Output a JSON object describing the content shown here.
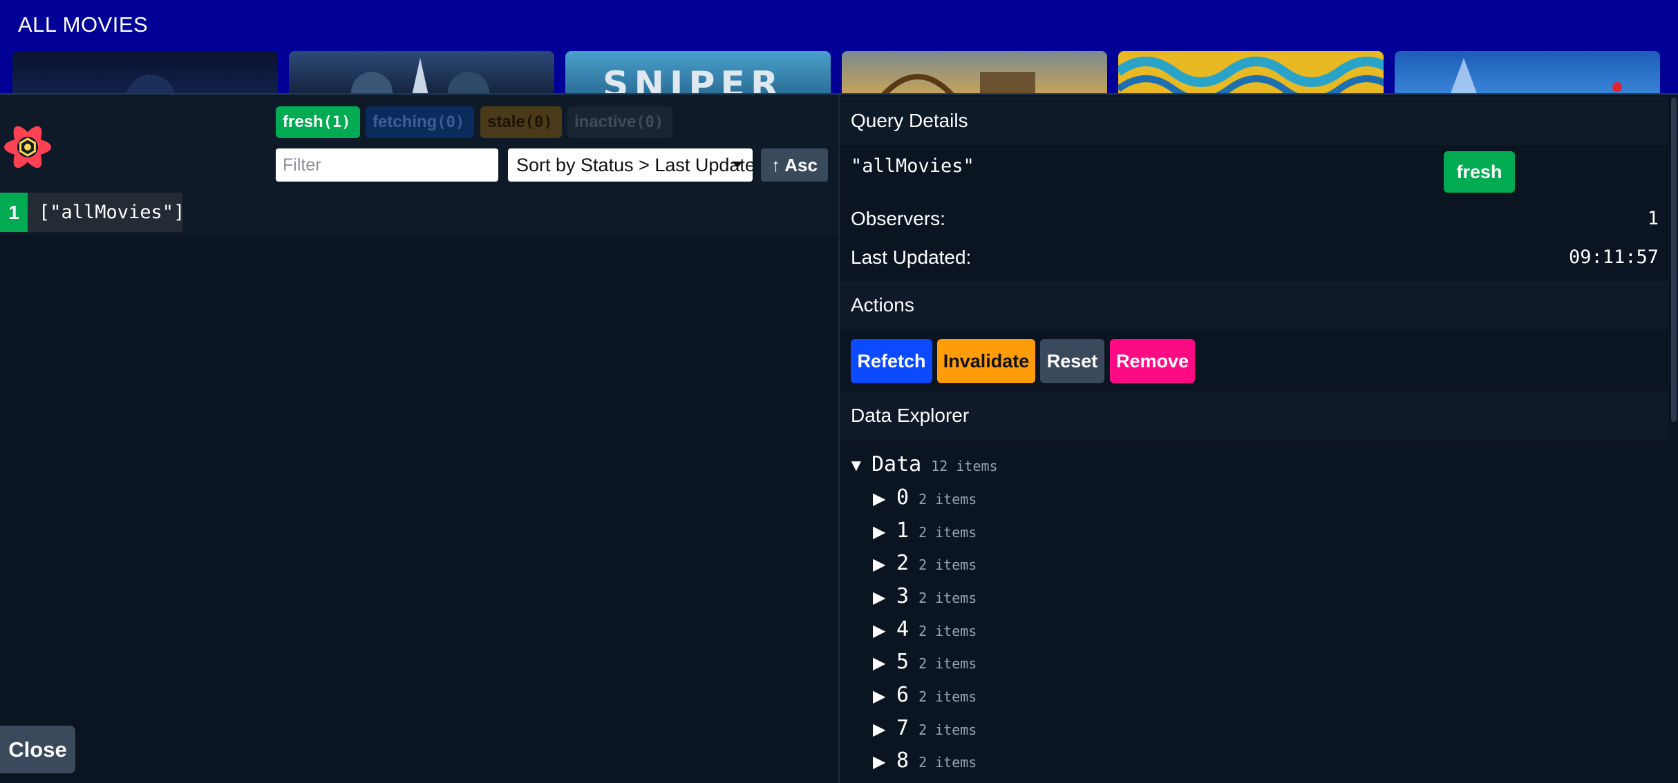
{
  "app": {
    "title": "ALL MOVIES",
    "posters": [
      {
        "name": "poster-1"
      },
      {
        "name": "poster-2"
      },
      {
        "name": "poster-3",
        "text": "SNIPER"
      },
      {
        "name": "poster-4"
      },
      {
        "name": "poster-5"
      },
      {
        "name": "poster-6"
      }
    ]
  },
  "devtools": {
    "logo_icon": "react-query-logo",
    "filters": [
      {
        "label": "fresh",
        "count": "(1)"
      },
      {
        "label": "fetching",
        "count": "(0)"
      },
      {
        "label": "stale",
        "count": "(0)"
      },
      {
        "label": "inactive",
        "count": "(0)"
      }
    ],
    "filter_placeholder": "Filter",
    "sort_label": "Sort by Status > Last Updated",
    "sort_icon": "chevron-down-icon",
    "asc_label": "↑ Asc",
    "queries": [
      {
        "count": "1",
        "key": "[\"allMovies\"]"
      }
    ],
    "close_label": "Close",
    "details": {
      "header": "Query Details",
      "key": "\"allMovies\"",
      "status": "fresh",
      "observers_label": "Observers:",
      "observers_value": "1",
      "last_updated_label": "Last Updated:",
      "last_updated_value": "09:11:57"
    },
    "actions": {
      "header": "Actions",
      "refetch": "Refetch",
      "invalidate": "Invalidate",
      "reset": "Reset",
      "remove": "Remove"
    },
    "explorer": {
      "header": "Data Explorer",
      "root": {
        "arrow": "▼",
        "key": "Data",
        "meta": "12 items"
      },
      "children": [
        {
          "arrow": "▶",
          "key": "0",
          "meta": "2 items"
        },
        {
          "arrow": "▶",
          "key": "1",
          "meta": "2 items"
        },
        {
          "arrow": "▶",
          "key": "2",
          "meta": "2 items"
        },
        {
          "arrow": "▶",
          "key": "3",
          "meta": "2 items"
        },
        {
          "arrow": "▶",
          "key": "4",
          "meta": "2 items"
        },
        {
          "arrow": "▶",
          "key": "5",
          "meta": "2 items"
        },
        {
          "arrow": "▶",
          "key": "6",
          "meta": "2 items"
        },
        {
          "arrow": "▶",
          "key": "7",
          "meta": "2 items"
        },
        {
          "arrow": "▶",
          "key": "8",
          "meta": "2 items"
        }
      ]
    },
    "colors": {
      "fresh": "#00ab52",
      "refetch": "#0b4aff",
      "invalidate": "#ff9c0a",
      "remove": "#ff0a85"
    }
  }
}
